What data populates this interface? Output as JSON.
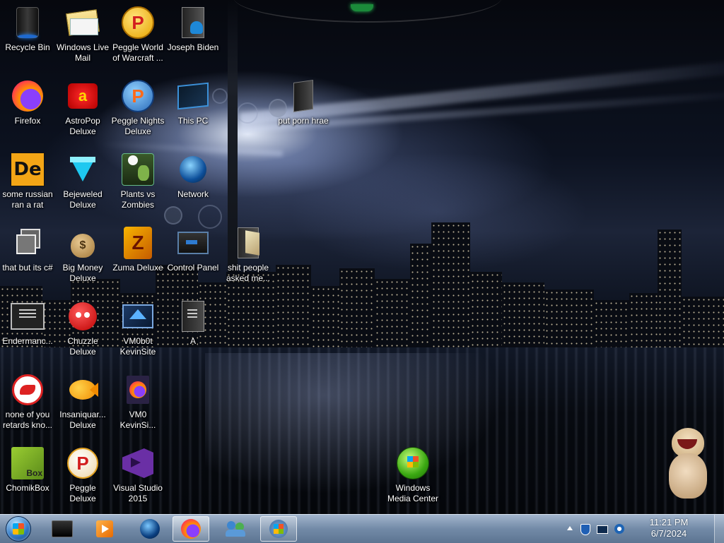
{
  "desktop": {
    "icons": [
      {
        "label": "Recycle Bin",
        "icon": "recycle-bin-icon"
      },
      {
        "label": "Windows Live Mail",
        "icon": "mail-icon"
      },
      {
        "label": "Peggle World of Warcraft ...",
        "icon": "peggle-icon"
      },
      {
        "label": "Joseph Biden",
        "icon": "user-folder-icon"
      },
      {
        "label": "Firefox",
        "icon": "firefox-icon"
      },
      {
        "label": "AstroPop Deluxe",
        "icon": "astropop-icon"
      },
      {
        "label": "Peggle Nights Deluxe",
        "icon": "peggle-nights-icon"
      },
      {
        "label": "This PC",
        "icon": "computer-icon"
      },
      {
        "label": "put porn hrae",
        "icon": "folder-icon"
      },
      {
        "label": "some russian ran a rat",
        "icon": "de-app-icon"
      },
      {
        "label": "Bejeweled Deluxe",
        "icon": "gem-icon"
      },
      {
        "label": "Plants vs Zombies",
        "icon": "plants-vs-zombies-icon"
      },
      {
        "label": "Network",
        "icon": "network-icon"
      },
      {
        "label": "that but its c#",
        "icon": "window-stack-icon"
      },
      {
        "label": "Big Money Deluxe",
        "icon": "money-bag-icon"
      },
      {
        "label": "Zuma Deluxe",
        "icon": "zuma-icon"
      },
      {
        "label": "Control Panel",
        "icon": "control-panel-icon"
      },
      {
        "label": "shit people asked me...",
        "icon": "open-folder-icon"
      },
      {
        "label": "Endermanc...",
        "icon": "terminal-icon"
      },
      {
        "label": "Chuzzle Deluxe",
        "icon": "chuzzle-icon"
      },
      {
        "label": "VM0b0t KevinSite",
        "icon": "vm-icon"
      },
      {
        "label": "A",
        "icon": "document-icon"
      },
      {
        "label": "none of you retards kno...",
        "icon": "red-dragon-icon"
      },
      {
        "label": "Insaniquar... Deluxe",
        "icon": "goldfish-icon"
      },
      {
        "label": "VM0 KevinSi...",
        "icon": "firefox-file-icon"
      },
      {
        "label": "ChomikBox",
        "icon": "chomikbox-icon"
      },
      {
        "label": "Peggle Deluxe",
        "icon": "peggle-deluxe-icon"
      },
      {
        "label": "Visual Studio 2015",
        "icon": "visual-studio-icon"
      },
      {
        "label": "Windows Media Center",
        "icon": "media-center-icon"
      }
    ]
  },
  "taskbar": {
    "start": "start-orb-icon",
    "items": [
      {
        "name": "terminal-window",
        "icon": "black-window-icon"
      },
      {
        "name": "media-player",
        "icon": "media-player-icon"
      },
      {
        "name": "globe",
        "icon": "globe-icon"
      },
      {
        "name": "firefox",
        "icon": "firefox-icon",
        "active": true
      },
      {
        "name": "users",
        "icon": "users-icon"
      },
      {
        "name": "windows-logo",
        "icon": "windows-logo-icon"
      }
    ],
    "tray": {
      "icons": [
        "show-hidden-arrow-icon",
        "security-shield-icon",
        "display-icon",
        "volume-icon"
      ],
      "time": "11:21 PM",
      "date": "6/7/2024"
    }
  }
}
